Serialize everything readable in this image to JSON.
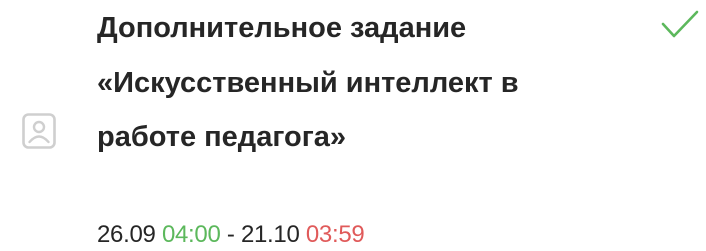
{
  "task": {
    "title": "Дополнительное задание «Искусственный интеллект в работе педагога»",
    "start_date": "26.09",
    "start_time": "04:00",
    "separator": " - ",
    "end_date": "21.10",
    "end_time": "03:59",
    "status": "completed"
  },
  "icons": {
    "left": "document-icon",
    "status": "check-icon"
  },
  "colors": {
    "title": "#262626",
    "start_time": "#5cb85c",
    "end_time": "#e05a5a",
    "check": "#5cb85c",
    "icon": "#cfcfcf"
  }
}
